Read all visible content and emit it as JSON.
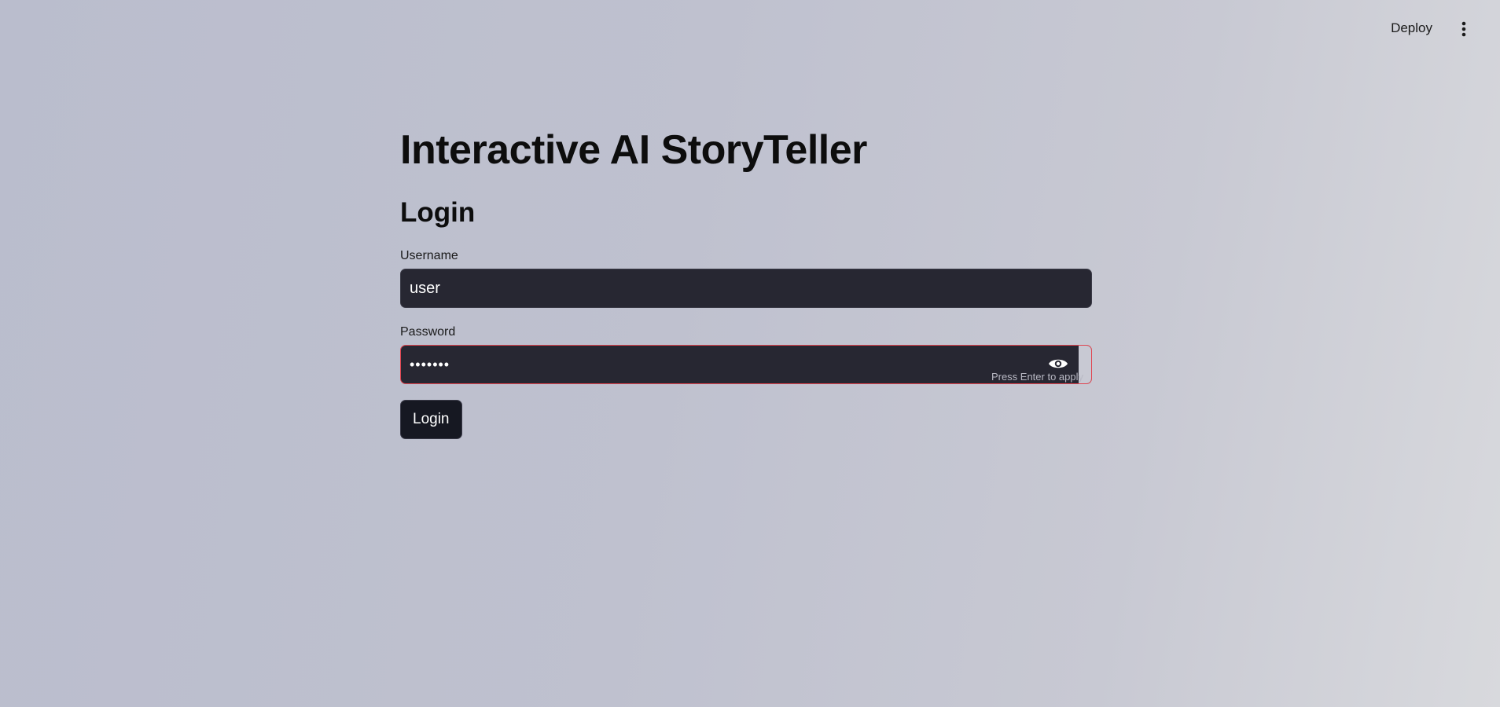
{
  "header": {
    "deploy_label": "Deploy",
    "menu_icon": "more-vertical-icon"
  },
  "main": {
    "title": "Interactive AI StoryTeller",
    "section_title": "Login",
    "username": {
      "label": "Username",
      "value": "user"
    },
    "password": {
      "label": "Password",
      "value": "•••••••",
      "hint": "Press Enter to apply",
      "toggle_icon": "eye-icon"
    },
    "login_button_label": "Login"
  },
  "colors": {
    "input_background": "#272732",
    "error_border": "#e0444f",
    "button_background": "#161822"
  }
}
